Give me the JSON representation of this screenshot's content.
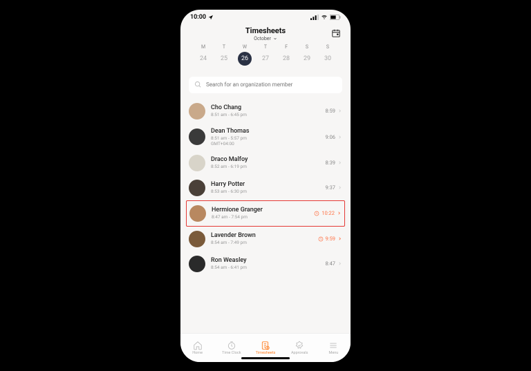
{
  "status": {
    "time": "10:00"
  },
  "header": {
    "title": "Timesheets",
    "subtitle": "October"
  },
  "week": [
    {
      "label": "M",
      "num": "24",
      "selected": false
    },
    {
      "label": "T",
      "num": "25",
      "selected": false
    },
    {
      "label": "W",
      "num": "26",
      "selected": true
    },
    {
      "label": "T",
      "num": "27",
      "selected": false
    },
    {
      "label": "F",
      "num": "28",
      "selected": false
    },
    {
      "label": "S",
      "num": "29",
      "selected": false
    },
    {
      "label": "S",
      "num": "30",
      "selected": false
    }
  ],
  "search": {
    "placeholder": "Search for an organization member"
  },
  "members": [
    {
      "name": "Cho Chang",
      "time": "8:51 am - 6:45 pm",
      "tz": "",
      "total": "8:59",
      "warn": false,
      "highlight": false,
      "avatar": "#c9a98a"
    },
    {
      "name": "Dean Thomas",
      "time": "8:51 am - 5:57 pm",
      "tz": "GMT+04:00",
      "total": "9:06",
      "warn": false,
      "highlight": false,
      "avatar": "#3a3a3a"
    },
    {
      "name": "Draco Malfoy",
      "time": "8:52 am - 6:19 pm",
      "tz": "",
      "total": "8:39",
      "warn": false,
      "highlight": false,
      "avatar": "#d8d4c9"
    },
    {
      "name": "Harry Potter",
      "time": "8:53 am - 6:30 pm",
      "tz": "",
      "total": "9:37",
      "warn": false,
      "highlight": false,
      "avatar": "#4a4038"
    },
    {
      "name": "Hermione Granger",
      "time": "8:47 am - 7:54 pm",
      "tz": "",
      "total": "10:22",
      "warn": true,
      "highlight": true,
      "avatar": "#b88860"
    },
    {
      "name": "Lavender Brown",
      "time": "8:54 am - 7:49 pm",
      "tz": "",
      "total": "9:59",
      "warn": true,
      "highlight": false,
      "avatar": "#7a5a3a"
    },
    {
      "name": "Ron Weasley",
      "time": "8:54 am - 6:41 pm",
      "tz": "",
      "total": "8:47",
      "warn": false,
      "highlight": false,
      "avatar": "#2a2a2a"
    }
  ],
  "tabs": [
    {
      "label": "Home",
      "active": false
    },
    {
      "label": "Time Clock",
      "active": false
    },
    {
      "label": "Timesheets",
      "active": true
    },
    {
      "label": "Approvals",
      "active": false
    },
    {
      "label": "Menu",
      "active": false
    }
  ]
}
